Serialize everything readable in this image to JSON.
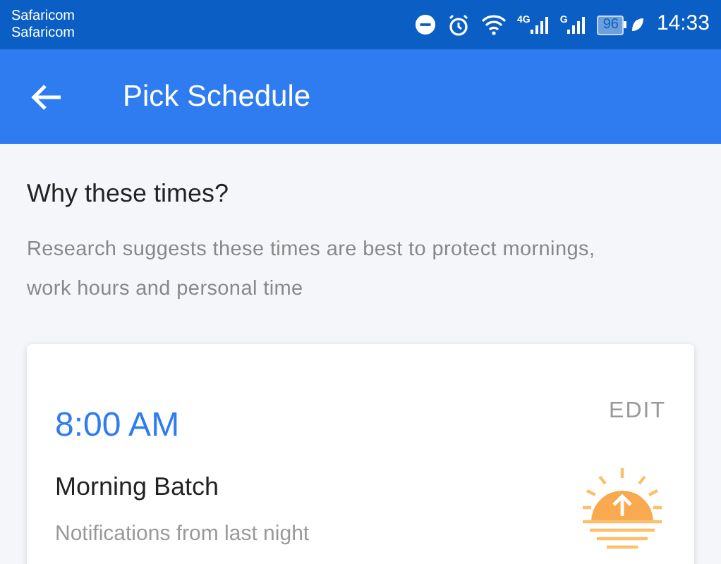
{
  "status_bar": {
    "carriers": [
      "Safaricom",
      "Safaricom"
    ],
    "signals": [
      "4G",
      "G"
    ],
    "battery": "96",
    "time": "14:33"
  },
  "app_bar": {
    "title": "Pick Schedule"
  },
  "info": {
    "heading": "Why these times?",
    "text": "Research suggests these times are best to protect mornings, work hours and personal time"
  },
  "cards": [
    {
      "time": "8:00 AM",
      "action": "EDIT",
      "name": "Morning Batch",
      "description": "Notifications from last night"
    }
  ]
}
